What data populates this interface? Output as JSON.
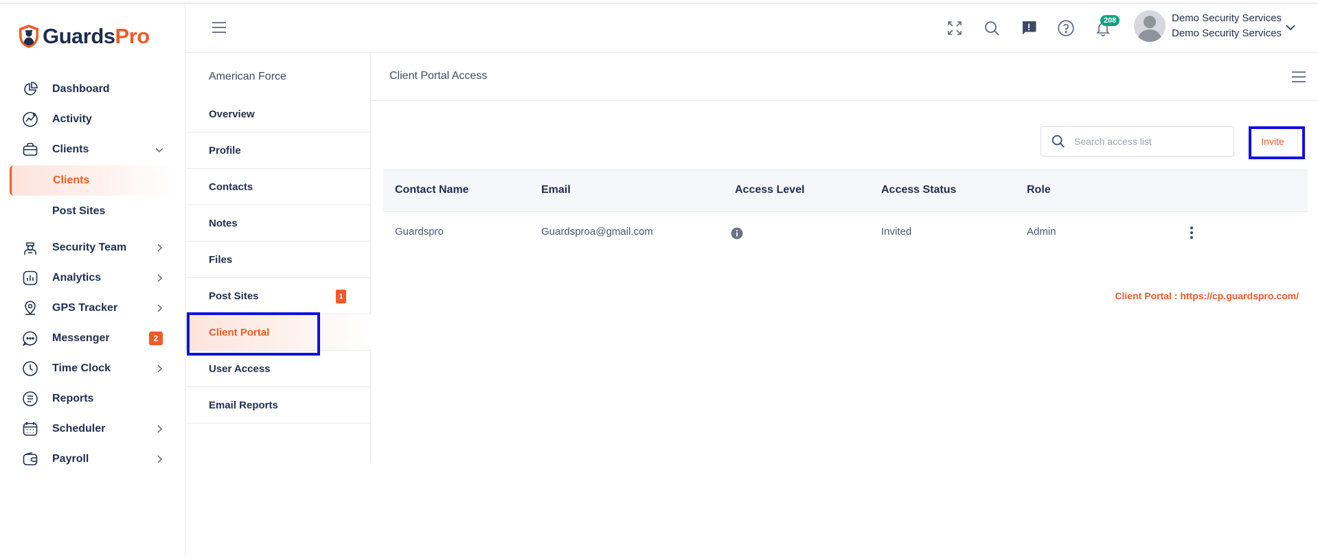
{
  "brand": {
    "part1": "Guards",
    "part2": "Pro",
    "primary_color": "#1f2d4d",
    "accent_color": "#f05a28"
  },
  "sidebar": {
    "items": [
      {
        "label": "Dashboard",
        "icon": "pie-chart-icon"
      },
      {
        "label": "Activity",
        "icon": "activity-icon"
      },
      {
        "label": "Clients",
        "icon": "briefcase-icon",
        "expanded": true
      },
      {
        "label": "Clients",
        "sub": true,
        "active": true
      },
      {
        "label": "Post Sites",
        "sub": true
      },
      {
        "label": "Security Team",
        "icon": "guard-icon"
      },
      {
        "label": "Analytics",
        "icon": "analytics-icon"
      },
      {
        "label": "GPS Tracker",
        "icon": "map-pin-icon"
      },
      {
        "label": "Messenger",
        "icon": "chat-icon",
        "badge": "2"
      },
      {
        "label": "Time Clock",
        "icon": "clock-icon"
      },
      {
        "label": "Reports",
        "icon": "report-icon"
      },
      {
        "label": "Scheduler",
        "icon": "calendar-icon"
      },
      {
        "label": "Payroll",
        "icon": "wallet-icon"
      }
    ]
  },
  "header": {
    "notification_count": "208",
    "notification_badge_color": "#10a37f",
    "user_name": "Demo Security Services",
    "user_org": "Demo Security Services"
  },
  "client_menu": {
    "client_name": "American Force",
    "items": [
      {
        "label": "Overview"
      },
      {
        "label": "Profile"
      },
      {
        "label": "Contacts"
      },
      {
        "label": "Notes"
      },
      {
        "label": "Files"
      },
      {
        "label": "Post Sites",
        "badge": "1"
      },
      {
        "label": "Client Portal",
        "active": true
      },
      {
        "label": "User Access"
      },
      {
        "label": "Email Reports"
      }
    ]
  },
  "content": {
    "title": "Client Portal Access",
    "search_placeholder": "Search access list",
    "invite_label": "Invite",
    "columns": [
      "Contact Name",
      "Email",
      "Access Level",
      "Access Status",
      "Role"
    ],
    "rows": [
      {
        "contact_name": "Guardspro",
        "email": "Guardsproa@gmail.com",
        "access_status": "Invited",
        "role": "Admin"
      }
    ],
    "portal_text": "Client Portal : https://cp.guardspro.com/"
  },
  "highlight_color": "#1010e0"
}
